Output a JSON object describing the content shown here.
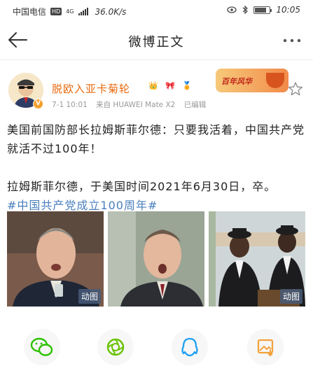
{
  "status_bar": {
    "carrier": "中国电信",
    "hd": "HD",
    "network": "4G",
    "speed": "36.0K/s",
    "battery_level": 0.8,
    "time": "10:05"
  },
  "nav": {
    "title": "微博正文",
    "back_icon": "arrow-left-icon",
    "more_icon": "more-dots-icon"
  },
  "post": {
    "username": "脱欧入亚卡菊轮",
    "badges": [
      "👑",
      "🎀",
      "🏅"
    ],
    "meta": {
      "time": "7-1 10:01",
      "source": "来自 HUAWEI Mate X2",
      "edited": "已编辑"
    },
    "promo_text": "百年风华",
    "paragraph1": "美国前国防部长拉姆斯菲尔德：只要我活着，中国共产党就活不过100年！",
    "paragraph2": "拉姆斯菲尔德，于美国时间2021年6月30日，卒。",
    "hashtag": "#中国共产党成立100周年#",
    "media": [
      {
        "gif_label": "动图"
      },
      {
        "gif_label": ""
      },
      {
        "gif_label": "动图"
      }
    ]
  },
  "share": {
    "items": [
      "wechat-icon",
      "moments-icon",
      "qq-icon",
      "save-image-icon"
    ]
  },
  "colors": {
    "username": "#e8690f",
    "hashtag": "#4a7fbd",
    "wechat": "#2dc100",
    "moments": "#68c300",
    "qq": "#1fa0f2",
    "save": "#f2a23a"
  }
}
